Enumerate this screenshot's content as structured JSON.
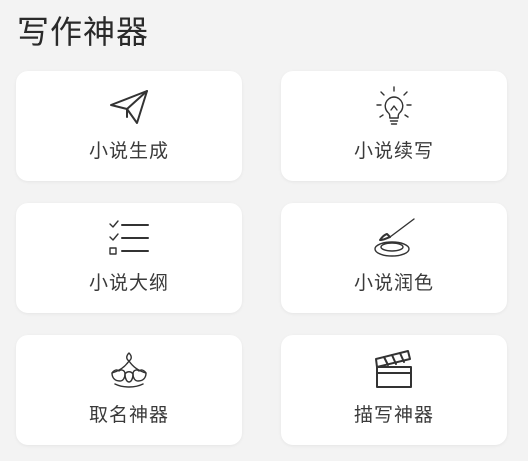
{
  "section": {
    "title": "写作神器"
  },
  "tools": [
    {
      "label": "小说生成",
      "icon": "paper-plane-icon"
    },
    {
      "label": "小说续写",
      "icon": "light-bulb-icon"
    },
    {
      "label": "小说大纲",
      "icon": "checklist-icon"
    },
    {
      "label": "小说润色",
      "icon": "brush-palette-icon"
    },
    {
      "label": "取名神器",
      "icon": "crown-icon"
    },
    {
      "label": "描写神器",
      "icon": "clapperboard-icon"
    }
  ],
  "colors": {
    "background": "#f3f3f3",
    "card": "#ffffff",
    "text": "#3a3a3a",
    "icon": "#333333"
  }
}
